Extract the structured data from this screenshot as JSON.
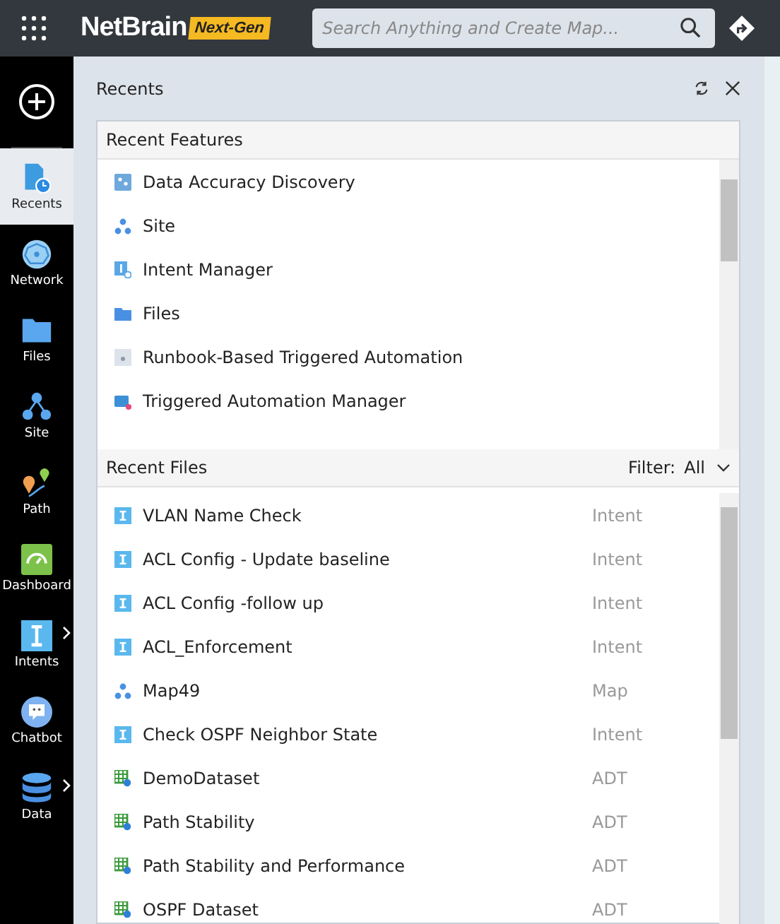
{
  "header": {
    "brand": "NetBrain",
    "badge": "Next-Gen",
    "search": {
      "placeholder": "Search Anything and Create Map..."
    }
  },
  "nav": [
    {
      "label": "Recents",
      "kind": "recents",
      "selected": true,
      "submenu": false
    },
    {
      "label": "Network",
      "kind": "network",
      "selected": false,
      "submenu": false
    },
    {
      "label": "Files",
      "kind": "files",
      "selected": false,
      "submenu": false
    },
    {
      "label": "Site",
      "kind": "site",
      "selected": false,
      "submenu": false
    },
    {
      "label": "Path",
      "kind": "path",
      "selected": false,
      "submenu": false
    },
    {
      "label": "Dashboard",
      "kind": "dashboard",
      "selected": false,
      "submenu": false
    },
    {
      "label": "Intents",
      "kind": "intents",
      "selected": false,
      "submenu": true
    },
    {
      "label": "Chatbot",
      "kind": "chatbot",
      "selected": false,
      "submenu": false
    },
    {
      "label": "Data",
      "kind": "data",
      "selected": false,
      "submenu": true
    }
  ],
  "panel": {
    "title": "Recents"
  },
  "recent_features": {
    "title": "Recent Features",
    "items": [
      {
        "label": "Data Accuracy Discovery",
        "kind": "discovery"
      },
      {
        "label": "Site",
        "kind": "site"
      },
      {
        "label": "Intent Manager",
        "kind": "intent-manager"
      },
      {
        "label": "Files",
        "kind": "folder"
      },
      {
        "label": "Runbook-Based Triggered Automation",
        "kind": "runbook"
      },
      {
        "label": "Triggered Automation Manager",
        "kind": "automation"
      }
    ]
  },
  "recent_files": {
    "title": "Recent Files",
    "filter_label": "Filter:",
    "filter_value": "All",
    "rows": [
      {
        "name": "VLAN Name Check",
        "type": "Intent",
        "kind": "intent"
      },
      {
        "name": "ACL Config - Update baseline",
        "type": "Intent",
        "kind": "intent"
      },
      {
        "name": "ACL Config -follow up",
        "type": "Intent",
        "kind": "intent"
      },
      {
        "name": "ACL_Enforcement",
        "type": "Intent",
        "kind": "intent"
      },
      {
        "name": "Map49",
        "type": "Map",
        "kind": "map"
      },
      {
        "name": "Check OSPF Neighbor State",
        "type": "Intent",
        "kind": "intent"
      },
      {
        "name": "DemoDataset",
        "type": "ADT",
        "kind": "adt"
      },
      {
        "name": "Path Stability",
        "type": "ADT",
        "kind": "adt"
      },
      {
        "name": "Path Stability and Performance",
        "type": "ADT",
        "kind": "adt"
      },
      {
        "name": "OSPF Dataset",
        "type": "ADT",
        "kind": "adt"
      }
    ]
  }
}
